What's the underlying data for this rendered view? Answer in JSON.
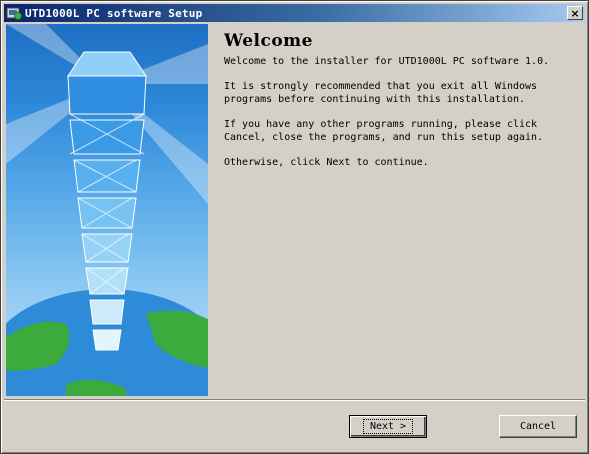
{
  "window": {
    "title": "UTD1000L PC software Setup",
    "close_label": "×"
  },
  "page": {
    "heading": "Welcome",
    "paragraphs": [
      "Welcome to the installer for UTD1000L PC software 1.0.",
      "It is strongly recommended that you exit all Windows programs before continuing with this installation.",
      "If you have any other programs running, please click Cancel, close the programs, and run this setup again.",
      "Otherwise, click Next to continue."
    ]
  },
  "buttons": {
    "next_label": "Next >",
    "cancel_label": "Cancel"
  },
  "icons": {
    "app": "installer-app-icon",
    "banner": "globe-tower-banner-image"
  },
  "colors": {
    "titlebar_start": "#0a246a",
    "titlebar_end": "#a6caf0",
    "dialog_bg": "#d4d0c8"
  }
}
